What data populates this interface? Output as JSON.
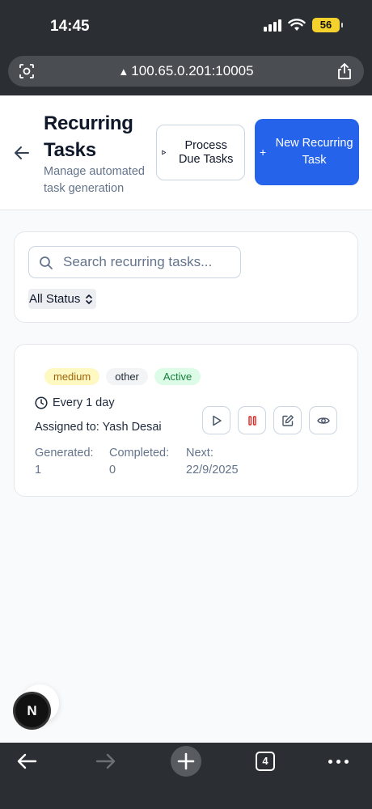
{
  "status_bar": {
    "time": "14:45",
    "battery": "56"
  },
  "browser": {
    "url": "100.65.0.201:10005",
    "tab_count": "4"
  },
  "header": {
    "title": "Recurring Tasks",
    "subtitle": "Manage automated task generation",
    "process_button": "Process Due Tasks",
    "new_button": "New Recurring Task"
  },
  "filter": {
    "search_placeholder": "Search recurring tasks...",
    "status_value": "All Status"
  },
  "task": {
    "priority": "medium",
    "category": "other",
    "state": "Active",
    "frequency": "Every 1 day",
    "assigned": "Assigned to: Yash Desai",
    "generated_label": "Generated:",
    "generated_value": "1",
    "completed_label": "Completed:",
    "completed_value": "0",
    "next_label": "Next:",
    "next_value": "22/9/2025"
  },
  "next_badge": "N",
  "colors": {
    "primary": "#2563eb",
    "pause": "#dc2626"
  }
}
